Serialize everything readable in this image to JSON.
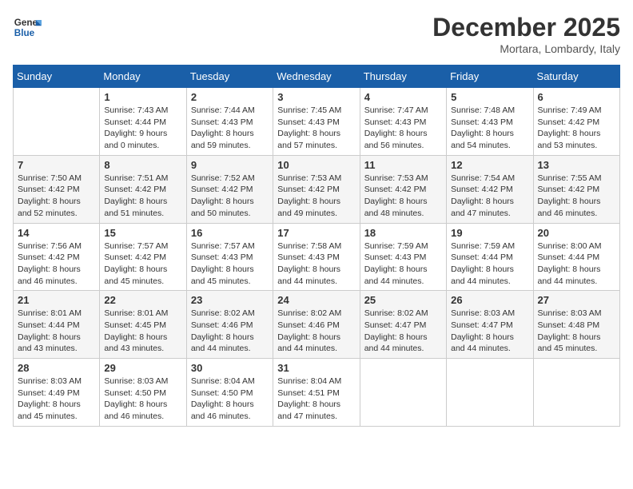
{
  "header": {
    "logo_line1": "General",
    "logo_line2": "Blue",
    "month": "December 2025",
    "location": "Mortara, Lombardy, Italy"
  },
  "days_of_week": [
    "Sunday",
    "Monday",
    "Tuesday",
    "Wednesday",
    "Thursday",
    "Friday",
    "Saturday"
  ],
  "weeks": [
    [
      {
        "day": "",
        "info": ""
      },
      {
        "day": "1",
        "info": "Sunrise: 7:43 AM\nSunset: 4:44 PM\nDaylight: 9 hours\nand 0 minutes."
      },
      {
        "day": "2",
        "info": "Sunrise: 7:44 AM\nSunset: 4:43 PM\nDaylight: 8 hours\nand 59 minutes."
      },
      {
        "day": "3",
        "info": "Sunrise: 7:45 AM\nSunset: 4:43 PM\nDaylight: 8 hours\nand 57 minutes."
      },
      {
        "day": "4",
        "info": "Sunrise: 7:47 AM\nSunset: 4:43 PM\nDaylight: 8 hours\nand 56 minutes."
      },
      {
        "day": "5",
        "info": "Sunrise: 7:48 AM\nSunset: 4:43 PM\nDaylight: 8 hours\nand 54 minutes."
      },
      {
        "day": "6",
        "info": "Sunrise: 7:49 AM\nSunset: 4:42 PM\nDaylight: 8 hours\nand 53 minutes."
      }
    ],
    [
      {
        "day": "7",
        "info": "Sunrise: 7:50 AM\nSunset: 4:42 PM\nDaylight: 8 hours\nand 52 minutes."
      },
      {
        "day": "8",
        "info": "Sunrise: 7:51 AM\nSunset: 4:42 PM\nDaylight: 8 hours\nand 51 minutes."
      },
      {
        "day": "9",
        "info": "Sunrise: 7:52 AM\nSunset: 4:42 PM\nDaylight: 8 hours\nand 50 minutes."
      },
      {
        "day": "10",
        "info": "Sunrise: 7:53 AM\nSunset: 4:42 PM\nDaylight: 8 hours\nand 49 minutes."
      },
      {
        "day": "11",
        "info": "Sunrise: 7:53 AM\nSunset: 4:42 PM\nDaylight: 8 hours\nand 48 minutes."
      },
      {
        "day": "12",
        "info": "Sunrise: 7:54 AM\nSunset: 4:42 PM\nDaylight: 8 hours\nand 47 minutes."
      },
      {
        "day": "13",
        "info": "Sunrise: 7:55 AM\nSunset: 4:42 PM\nDaylight: 8 hours\nand 46 minutes."
      }
    ],
    [
      {
        "day": "14",
        "info": "Sunrise: 7:56 AM\nSunset: 4:42 PM\nDaylight: 8 hours\nand 46 minutes."
      },
      {
        "day": "15",
        "info": "Sunrise: 7:57 AM\nSunset: 4:42 PM\nDaylight: 8 hours\nand 45 minutes."
      },
      {
        "day": "16",
        "info": "Sunrise: 7:57 AM\nSunset: 4:43 PM\nDaylight: 8 hours\nand 45 minutes."
      },
      {
        "day": "17",
        "info": "Sunrise: 7:58 AM\nSunset: 4:43 PM\nDaylight: 8 hours\nand 44 minutes."
      },
      {
        "day": "18",
        "info": "Sunrise: 7:59 AM\nSunset: 4:43 PM\nDaylight: 8 hours\nand 44 minutes."
      },
      {
        "day": "19",
        "info": "Sunrise: 7:59 AM\nSunset: 4:44 PM\nDaylight: 8 hours\nand 44 minutes."
      },
      {
        "day": "20",
        "info": "Sunrise: 8:00 AM\nSunset: 4:44 PM\nDaylight: 8 hours\nand 44 minutes."
      }
    ],
    [
      {
        "day": "21",
        "info": "Sunrise: 8:01 AM\nSunset: 4:44 PM\nDaylight: 8 hours\nand 43 minutes."
      },
      {
        "day": "22",
        "info": "Sunrise: 8:01 AM\nSunset: 4:45 PM\nDaylight: 8 hours\nand 43 minutes."
      },
      {
        "day": "23",
        "info": "Sunrise: 8:02 AM\nSunset: 4:46 PM\nDaylight: 8 hours\nand 44 minutes."
      },
      {
        "day": "24",
        "info": "Sunrise: 8:02 AM\nSunset: 4:46 PM\nDaylight: 8 hours\nand 44 minutes."
      },
      {
        "day": "25",
        "info": "Sunrise: 8:02 AM\nSunset: 4:47 PM\nDaylight: 8 hours\nand 44 minutes."
      },
      {
        "day": "26",
        "info": "Sunrise: 8:03 AM\nSunset: 4:47 PM\nDaylight: 8 hours\nand 44 minutes."
      },
      {
        "day": "27",
        "info": "Sunrise: 8:03 AM\nSunset: 4:48 PM\nDaylight: 8 hours\nand 45 minutes."
      }
    ],
    [
      {
        "day": "28",
        "info": "Sunrise: 8:03 AM\nSunset: 4:49 PM\nDaylight: 8 hours\nand 45 minutes."
      },
      {
        "day": "29",
        "info": "Sunrise: 8:03 AM\nSunset: 4:50 PM\nDaylight: 8 hours\nand 46 minutes."
      },
      {
        "day": "30",
        "info": "Sunrise: 8:04 AM\nSunset: 4:50 PM\nDaylight: 8 hours\nand 46 minutes."
      },
      {
        "day": "31",
        "info": "Sunrise: 8:04 AM\nSunset: 4:51 PM\nDaylight: 8 hours\nand 47 minutes."
      },
      {
        "day": "",
        "info": ""
      },
      {
        "day": "",
        "info": ""
      },
      {
        "day": "",
        "info": ""
      }
    ]
  ]
}
